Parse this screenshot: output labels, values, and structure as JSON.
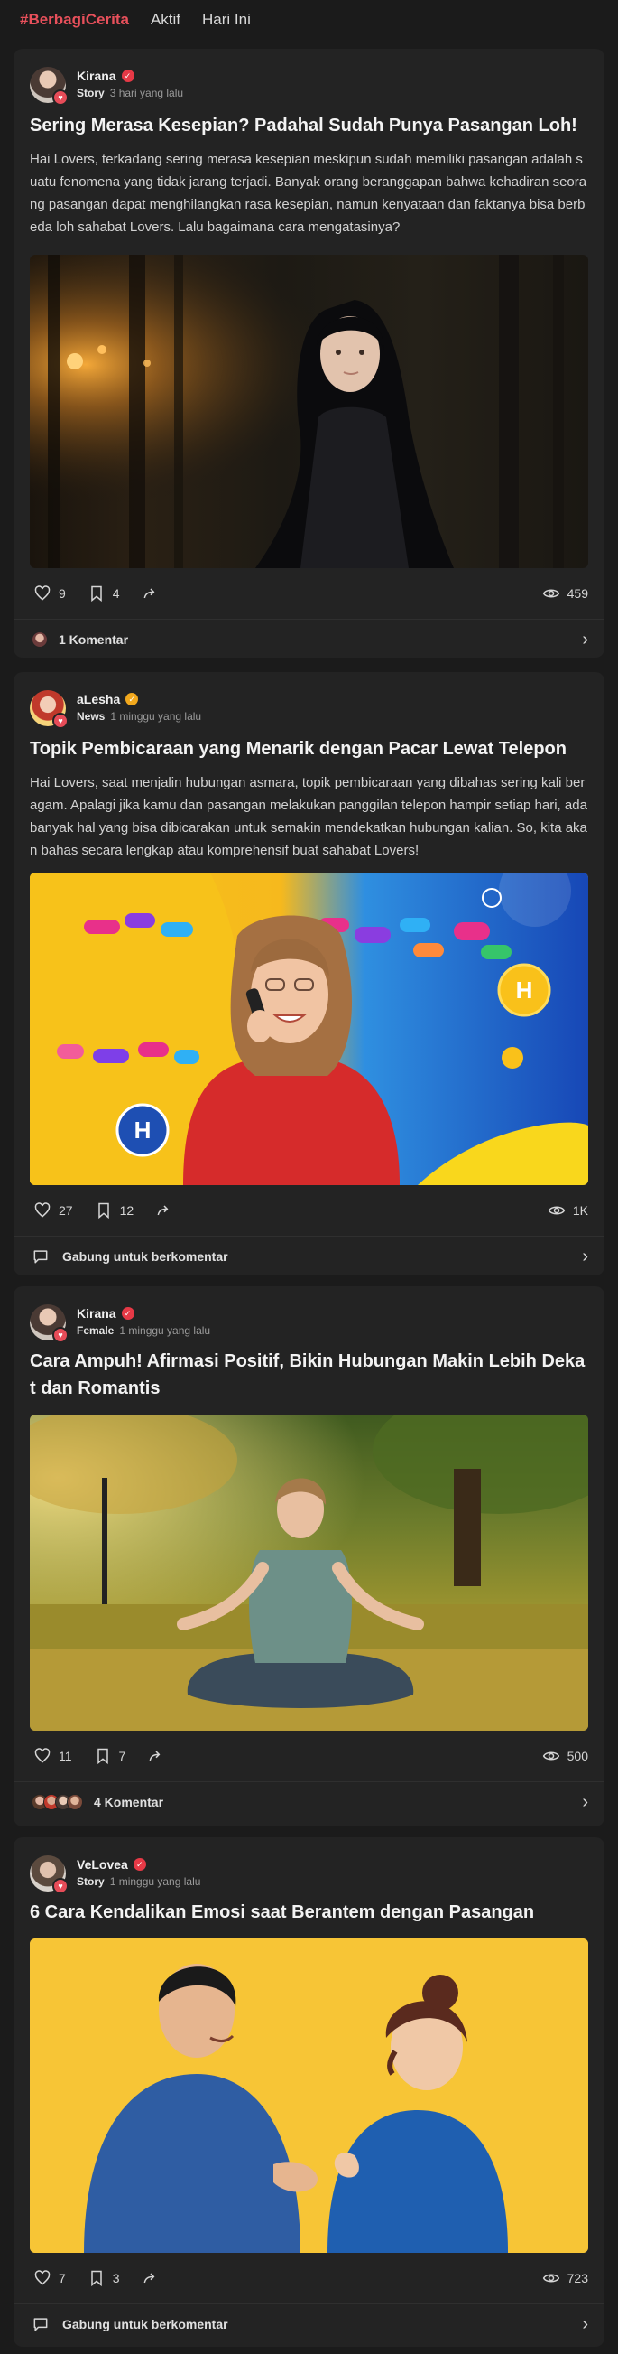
{
  "tabs": [
    {
      "label": "#BerbagiCerita",
      "active": true
    },
    {
      "label": "Aktif",
      "active": false
    },
    {
      "label": "Hari Ini",
      "active": false
    }
  ],
  "posts": [
    {
      "author": "Kirana",
      "badge_color": "#e63946",
      "category": "Story",
      "time": "3 hari yang lalu",
      "title": "Sering Merasa Kesepian? Padahal Sudah Punya Pasangan Loh!",
      "excerpt": "Hai Lovers, terkadang sering merasa kesepian meskipun sudah memiliki pasangan adalah suatu fenomena yang tidak jarang terjadi. Banyak orang beranggapan bahwa kehadiran seorang pasangan dapat menghilangkan rasa kesepian, namun kenyataan dan faktanya bisa berbeda loh sahabat Lovers. Lalu bagaimana cara mengatasinya?",
      "likes": "9",
      "bookmarks": "4",
      "views": "459",
      "comment_label": "1 Komentar"
    },
    {
      "author": "aLesha",
      "badge_color": "#f2a81d",
      "category": "News",
      "time": "1 minggu yang lalu",
      "title": "Topik Pembicaraan yang Menarik dengan Pacar Lewat Telepon",
      "excerpt": "Hai Lovers, saat menjalin hubungan asmara, topik pembicaraan yang dibahas sering kali beragam. Apalagi jika kamu dan pasangan melakukan panggilan telepon hampir setiap hari, ada banyak hal yang bisa dibicarakan untuk semakin mendekatkan hubungan kalian. So, kita akan bahas secara lengkap atau komprehensif buat sahabat Lovers!",
      "likes": "27",
      "bookmarks": "12",
      "views": "1K",
      "comment_label": "Gabung untuk berkomentar"
    },
    {
      "author": "Kirana",
      "badge_color": "#e63946",
      "category": "Female",
      "time": "1 minggu yang lalu",
      "title": "Cara Ampuh! Afirmasi Positif, Bikin Hubungan Makin Lebih Dekat dan Romantis",
      "excerpt": "",
      "likes": "11",
      "bookmarks": "7",
      "views": "500",
      "comment_label": "4 Komentar"
    },
    {
      "author": "VeLovea",
      "badge_color": "#e63946",
      "category": "Story",
      "time": "1 minggu yang lalu",
      "title": "6 Cara Kendalikan Emosi saat Berantem dengan Pasangan",
      "excerpt": "",
      "likes": "7",
      "bookmarks": "3",
      "views": "723",
      "comment_label": "Gabung untuk berkomentar"
    }
  ],
  "image_text": {
    "badge_letter": "H"
  },
  "colors": {
    "accent": "#e8505b",
    "card_bg": "#232323",
    "page_bg": "#1b1b1b"
  }
}
